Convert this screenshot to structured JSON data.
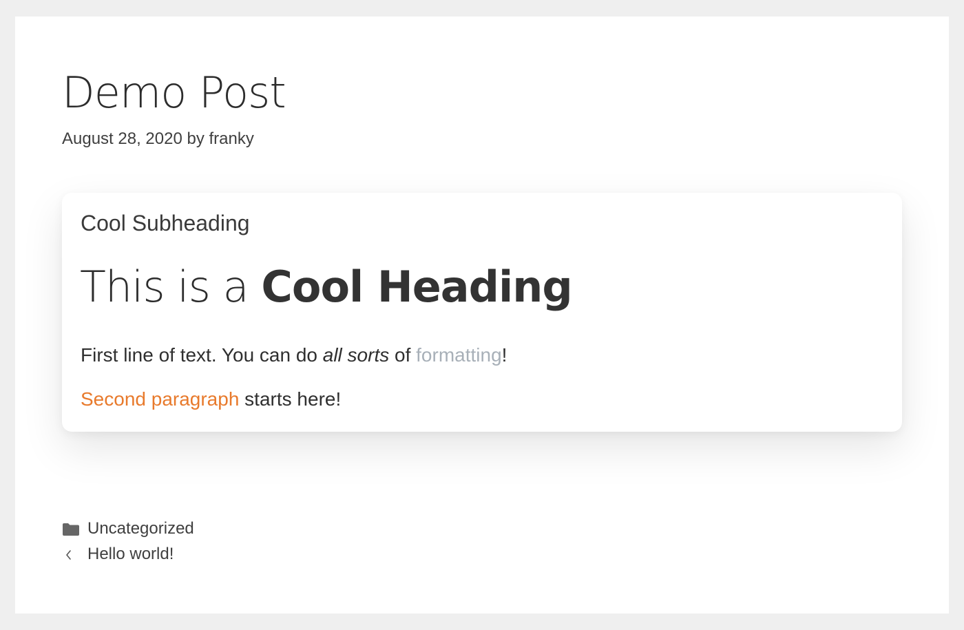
{
  "post": {
    "title": "Demo Post",
    "date": "August 28, 2020",
    "by": "by",
    "author": "franky"
  },
  "card": {
    "subheading": "Cool Subheading",
    "heading_light": "This is a ",
    "heading_bold": "Cool Heading",
    "line1_a": "First line of text. You can do ",
    "line1_italic": "all sorts",
    "line1_b": " of ",
    "line1_link": "formatting",
    "line1_end": "!",
    "line2_link": "Second paragraph",
    "line2_rest": " starts here!"
  },
  "footer": {
    "category_icon": "folder-icon",
    "category": "Uncategorized",
    "nav_icon": "chevron-left-icon",
    "prev_post": "Hello world!"
  },
  "colors": {
    "background": "#efefef",
    "link_grey": "#a8b0b8",
    "link_orange": "#e87a2c"
  }
}
